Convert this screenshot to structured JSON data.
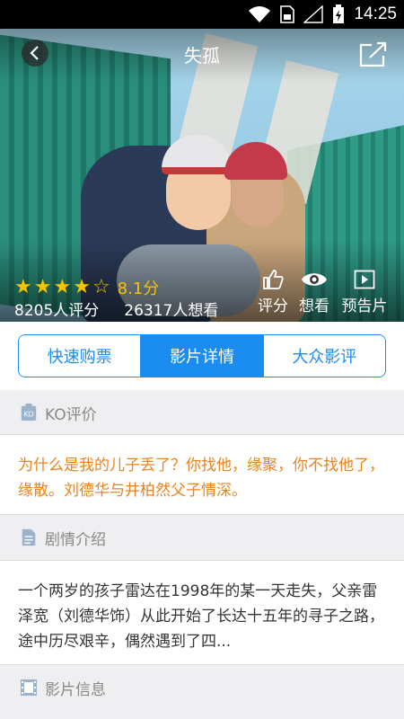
{
  "status_bar": {
    "time": "14:25"
  },
  "header": {
    "title": "失孤"
  },
  "hero": {
    "stars_filled": 4,
    "stars_half": 1,
    "score": "8.1分",
    "rating_count": "8205人评分",
    "want_count": "26317人想看",
    "actions": {
      "rate": "评分",
      "want": "想看",
      "trailer": "预告片"
    }
  },
  "tabs": [
    {
      "label": "快速购票",
      "active": false
    },
    {
      "label": "影片详情",
      "active": true
    },
    {
      "label": "大众影评",
      "active": false
    }
  ],
  "ko": {
    "icon_text": "KO",
    "title": "KO评价",
    "text": "为什么是我的儿子丢了？你找他，缘聚，你不找他了，缘散。刘德华与井柏然父子情深。"
  },
  "plot": {
    "title": "剧情介绍",
    "text": "一个两岁的孩子雷达在1998年的某一天走失，父亲雷泽宽（刘德华饰）从此开始了长达十五年的寻子之路，途中历尽艰辛，偶然遇到了四..."
  },
  "info": {
    "title": "影片信息"
  },
  "colors": {
    "accent": "#1b8cf0",
    "ko_text": "#e8831e",
    "star": "#f5c400"
  }
}
